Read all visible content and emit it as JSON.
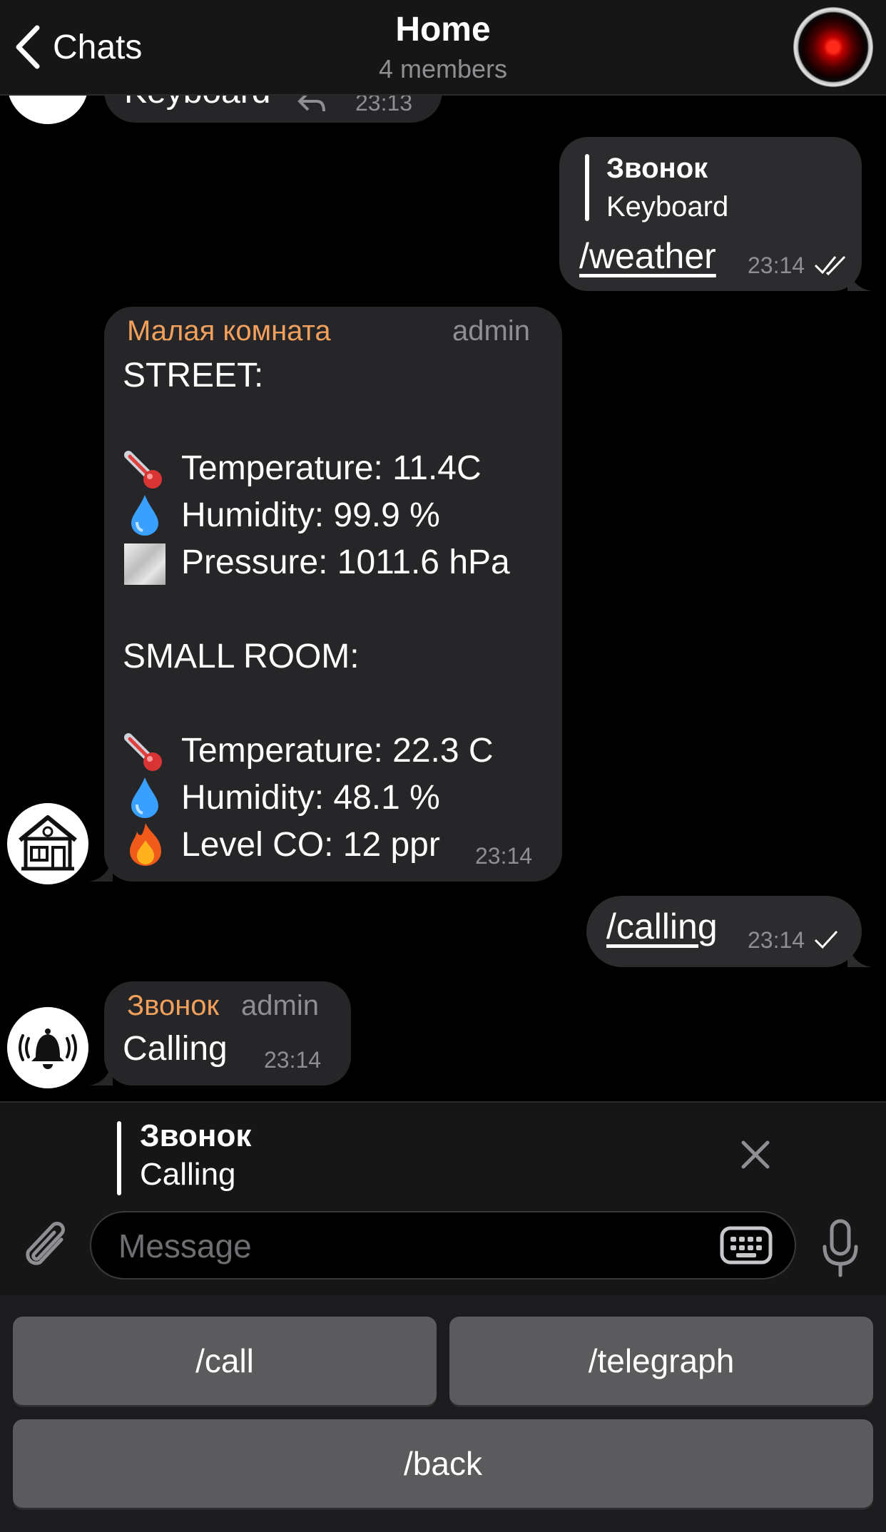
{
  "header": {
    "back_label": "Chats",
    "title": "Home",
    "subtitle": "4 members"
  },
  "messages": {
    "partial_top": {
      "text": "Keyboard",
      "time": "23:13"
    },
    "weather_cmd": {
      "quote_title": "Звонок",
      "quote_text": "Keyboard",
      "text": "/weather",
      "time": "23:14"
    },
    "weather_reply": {
      "sender": "Малая комната",
      "role": "admin",
      "lines": [
        "STREET:",
        "Temperature: 11.4C",
        "Humidity: 99.9 %",
        "Pressure: 1011.6 hPa",
        "SMALL ROOM:",
        "Temperature: 22.3 C",
        "Humidity: 48.1 %",
        "Level CO: 12 ppr"
      ],
      "time": "23:14"
    },
    "calling_cmd": {
      "text": "/calling",
      "time": "23:14"
    },
    "calling_reply": {
      "sender": "Звонок",
      "role": "admin",
      "text": "Calling",
      "time": "23:14"
    }
  },
  "reply_panel": {
    "title": "Звонок",
    "text": "Calling"
  },
  "composer": {
    "placeholder": "Message"
  },
  "keyboard": {
    "buttons": [
      "/call",
      "/telegraph",
      "/back"
    ]
  },
  "colors": {
    "sender": "#f2a05c",
    "bubble": "#262628",
    "background": "#000000"
  }
}
